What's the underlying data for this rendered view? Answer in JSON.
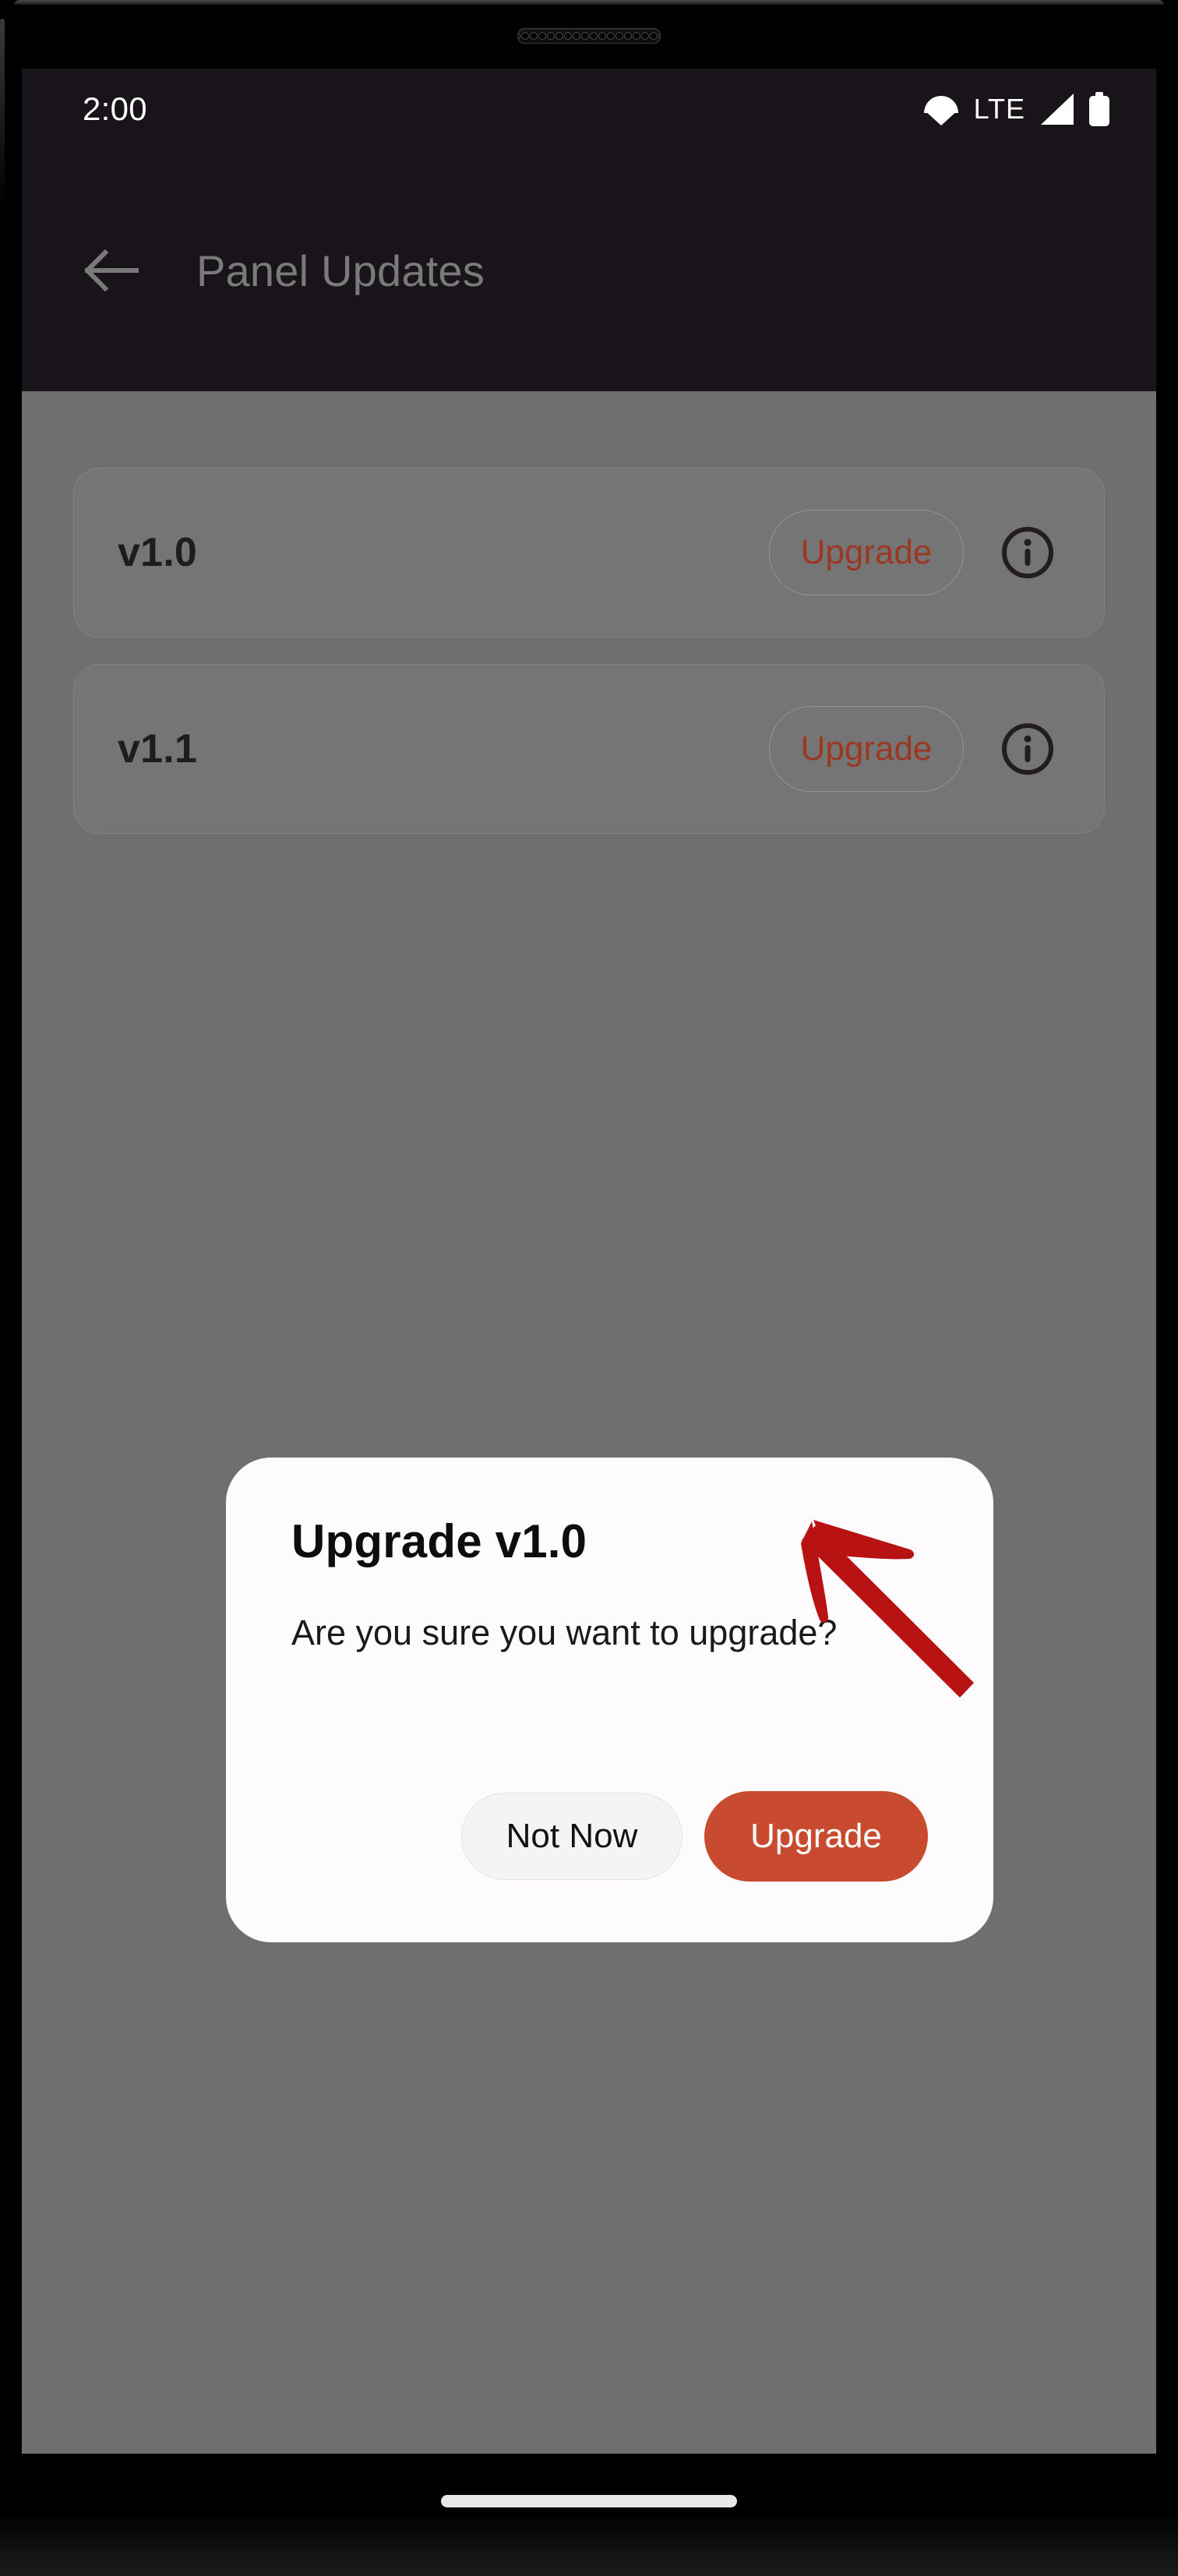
{
  "device": {
    "earpiece_icon": "speaker-grille-icon"
  },
  "status_bar": {
    "time": "2:00",
    "network_label": "LTE",
    "icons": [
      "wifi-icon",
      "signal-icon",
      "battery-icon"
    ]
  },
  "app_bar": {
    "back_icon": "back-arrow-icon",
    "title": "Panel Updates"
  },
  "updates": {
    "items": [
      {
        "version": "v1.0",
        "action_label": "Upgrade",
        "info_icon": "info-icon"
      },
      {
        "version": "v1.1",
        "action_label": "Upgrade",
        "info_icon": "info-icon"
      }
    ]
  },
  "dialog": {
    "title": "Upgrade v1.0",
    "message": "Are you sure you want to upgrade?",
    "cancel_label": "Not Now",
    "confirm_label": "Upgrade"
  },
  "annotation": {
    "arrow_icon": "pointer-arrow-icon",
    "arrow_color": "#b81212",
    "target": "Upgrade"
  },
  "nav_bar": {
    "home_indicator": "home-indicator"
  },
  "colors": {
    "app_bar_bg": "#191419",
    "scrim": "#6f6f6f",
    "accent": "#c84b2f",
    "card_accent_text": "#9c3722",
    "dialog_bg": "#fdfbfd",
    "title_text": "#7a7a7a"
  }
}
